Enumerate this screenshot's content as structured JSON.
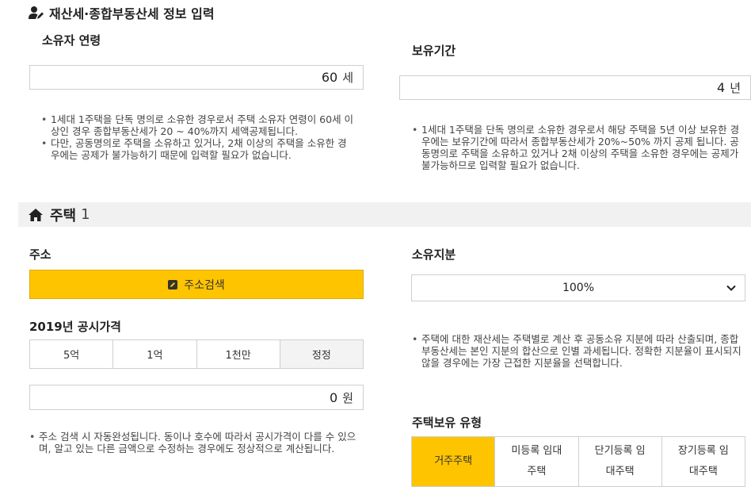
{
  "header": {
    "title": "재산세·종합부동산세 정보 입력"
  },
  "owner_age": {
    "label": "소유자 연령",
    "value": "60",
    "unit": "세",
    "notes": [
      "1세대 1주택을 단독 명의로 소유한 경우로서 주택 소유자 연령이 60세 이상인 경우 종합부동산세가 20 ~ 40%까지 세액공제됩니다.",
      "다만, 공동명의로 주택을 소유하고 있거나, 2채 이상의 주택을 소유한 경우에는 공제가 불가능하기 때문에 입력할 필요가 없습니다."
    ]
  },
  "holding_period": {
    "label": "보유기간",
    "value": "4",
    "unit": "년",
    "notes": [
      "1세대 1주택을 단독 명의로 소유한 경우로서 해당 주택을 5년 이상 보유한 경우에는 보유기간에 따라서 종합부동산세가 20%~50% 까지 공제 됩니다. 공동명의로 주택을 소유하고 있거나 2채 이상의 주택을 소유한 경우에는 공제가 불가능하므로 입력할 필요가 없습니다."
    ]
  },
  "house": {
    "title": "주택",
    "number": "1"
  },
  "address": {
    "label": "주소",
    "search_button": "주소검색"
  },
  "price": {
    "label": "2019년 공시가격",
    "buttons": [
      "5억",
      "1억",
      "1천만",
      "정정"
    ],
    "value": "0",
    "unit": "원",
    "notes": [
      "주소 검색 시 자동완성됩니다. 동이나 호수에 따라서 공시가격이 다를 수 있으며, 알고 있는 다른 금액으로 수정하는 경우에도 정상적으로 계산됩니다."
    ]
  },
  "ownership_share": {
    "label": "소유지분",
    "selected": "100%",
    "notes": [
      "주택에 대한 재산세는 주택별로 계산 후 공동소유 지분에 따라 산출되며, 종합부동산세는 본인 지분의 합산으로 인별 과세됩니다. 정확한 지분율이 표시되지 않을 경우에는 가장 근접한 지분율을 선택합니다."
    ]
  },
  "house_type": {
    "label": "주택보유 유형",
    "options": [
      {
        "line1": "거주주택",
        "line2": ""
      },
      {
        "line1": "미등록 임대",
        "line2": "주택"
      },
      {
        "line1": "단기등록 임",
        "line2": "대주택"
      },
      {
        "line1": "장기등록 임",
        "line2": "대주택"
      }
    ]
  },
  "colors": {
    "accent_yellow": "#ffc400",
    "bar_gray": "#f1f1f1"
  }
}
